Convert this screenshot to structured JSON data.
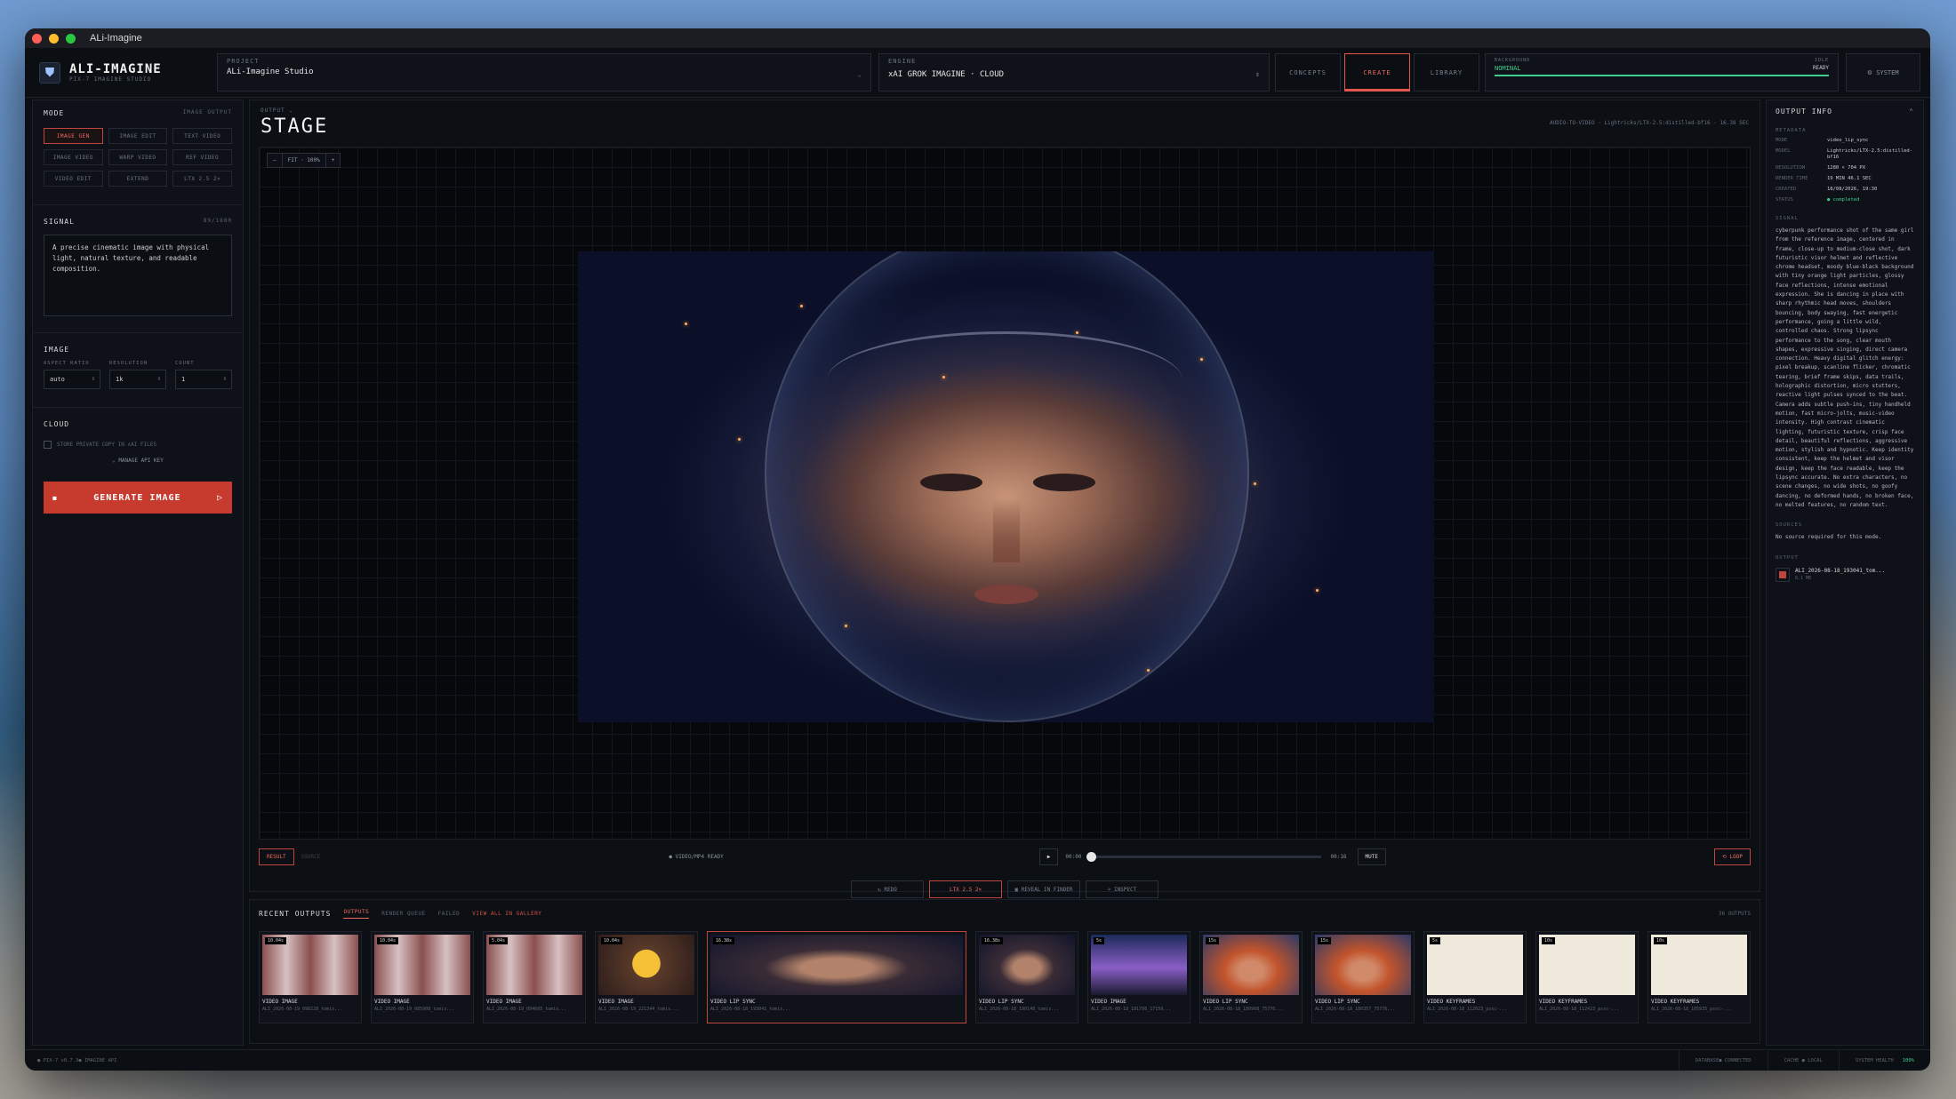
{
  "window": {
    "title": "ALi-Imagine"
  },
  "brand": {
    "name": "ALI-IMAGINE",
    "sub": "PIX-7 IMAGINE STUDIO"
  },
  "project": {
    "label": "PROJECT",
    "value": "ALi-Imagine Studio"
  },
  "engine": {
    "label": "ENGINE",
    "value": "xAI GROK IMAGINE · CLOUD"
  },
  "nav": {
    "concepts": "CONCEPTS",
    "create": "CREATE",
    "library": "LIBRARY"
  },
  "background": {
    "label": "BACKGROUND",
    "status": "NOMINAL",
    "idle": "IDLE",
    "ready": "READY"
  },
  "system": {
    "label": "SYSTEM"
  },
  "mode": {
    "title": "MODE",
    "right": "IMAGE OUTPUT",
    "buttons": [
      "IMAGE GEN",
      "IMAGE EDIT",
      "TEXT VIDEO",
      "IMAGE VIDEO",
      "WARP VIDEO",
      "REF VIDEO",
      "VIDEO EDIT",
      "EXTEND",
      "LTX 2.5 2×"
    ]
  },
  "signal": {
    "title": "SIGNAL",
    "count": "89/1800",
    "text": "A precise cinematic image with physical light, natural texture, and readable composition."
  },
  "image": {
    "title": "IMAGE",
    "aspect": {
      "label": "ASPECT RATIO",
      "value": "auto"
    },
    "resolution": {
      "label": "RESOLUTION",
      "value": "1k"
    },
    "count": {
      "label": "COUNT",
      "value": "1"
    }
  },
  "cloud": {
    "title": "CLOUD",
    "store": "STORE PRIVATE COPY IN xAI FILES",
    "apikey": "⌄ MANAGE API KEY"
  },
  "generate": {
    "label": "GENERATE IMAGE",
    "arrow": "▷"
  },
  "stage": {
    "output_label": "OUTPUT ⌄",
    "title": "STAGE",
    "meta": "AUDIO-TO-VIDEO · Lightricks/LTX-2.5:distilled-bf16 · 16.38 SEC",
    "zoom": {
      "minus": "–",
      "fit": "FIT · 100%",
      "plus": "+"
    }
  },
  "controls": {
    "result": "RESULT",
    "source": "SOURCE",
    "ready": "● VIDEO/MP4 READY",
    "play": "▶",
    "time_start": "00:00",
    "time_end": "00:16",
    "mute": "MUTE",
    "loop": "⟲ LOOP"
  },
  "actions": [
    "↻ REDO",
    "LTX 2.5 2×",
    "▣ REVEAL IN FINDER",
    "⌕ INSPECT"
  ],
  "recent": {
    "title": "RECENT OUTPUTS",
    "tabs": [
      "OUTPUTS",
      "RENDER QUEUE",
      "FAILED"
    ],
    "gallery": "VIEW ALL IN GALLERY",
    "count": "36 OUTPUTS",
    "items": [
      {
        "badge": "10.04s",
        "kind": "VIDEO IMAGE",
        "file": "ALI_2026-08-19_090228_tomis..."
      },
      {
        "badge": "10.04s",
        "kind": "VIDEO IMAGE",
        "file": "ALI_2026-08-19_085908_tomis..."
      },
      {
        "badge": "5.04s",
        "kind": "VIDEO IMAGE",
        "file": "ALI_2026-08-19_084605_tomis..."
      },
      {
        "badge": "10.04s",
        "kind": "VIDEO IMAGE",
        "file": "ALI_2026-08-19_221344_tomis..."
      },
      {
        "badge": "16.38s",
        "kind": "VIDEO LIP SYNC",
        "file": "ALI_2026-08-18_193041_tomis..."
      },
      {
        "badge": "16.38s",
        "kind": "VIDEO LIP SYNC",
        "file": "ALI_2026-08-18_190148_tomis..."
      },
      {
        "badge": "5s",
        "kind": "VIDEO IMAGE",
        "file": "ALI_2026-08-18_181706_17159..."
      },
      {
        "badge": "15s",
        "kind": "VIDEO LIP SYNC",
        "file": "ALI_2026-08-18_180908_75776..."
      },
      {
        "badge": "15s",
        "kind": "VIDEO LIP SYNC",
        "file": "ALI_2026-08-18_180357_75776..."
      },
      {
        "badge": "5s",
        "kind": "VIDEO KEYFRAMES",
        "file": "ALI_2026-08-18_112023_pssc-..."
      },
      {
        "badge": "10s",
        "kind": "VIDEO KEYFRAMES",
        "file": "ALI_2026-08-18_112423_pssc-..."
      },
      {
        "badge": "10s",
        "kind": "VIDEO KEYFRAMES",
        "file": "ALI_2026-08-18_105935_pssc-..."
      }
    ]
  },
  "info": {
    "title": "OUTPUT INFO",
    "metadata_label": "METADATA",
    "rows": [
      {
        "k": "MODE",
        "v": "video_lip_sync"
      },
      {
        "k": "MODEL",
        "v": "Lightricks/LTX-2.5:distilled-bf16"
      },
      {
        "k": "RESOLUTION",
        "v": "1280 × 704 PX"
      },
      {
        "k": "RENDER TIME",
        "v": "19 MIN 46.1 SEC"
      },
      {
        "k": "CREATED",
        "v": "18/08/2026, 19:30"
      },
      {
        "k": "STATUS",
        "v": "● completed"
      }
    ],
    "signal_label": "SIGNAL",
    "signal": "cyberpunk performance shot of the same girl from the reference image, centered in frame, close-up to medium-close shot, dark futuristic visor helmet and reflective chrome headset, moody blue-black background with tiny orange light particles, glossy face reflections, intense emotional expression. She is dancing in place with sharp rhythmic head moves, shoulders bouncing, body swaying, fast energetic performance, going a little wild, controlled chaos. Strong lipsync performance to the song, clear mouth shapes, expressive singing, direct camera connection. Heavy digital glitch energy: pixel breakup, scanline flicker, chromatic tearing, brief frame skips, data trails, holographic distortion, micro stutters, reactive light pulses synced to the beat. Camera adds subtle push-ins, tiny handheld motion, fast micro-jolts, music-video intensity. High contrast cinematic lighting, futuristic texture, crisp face detail, beautiful reflections, aggressive motion, stylish and hypnotic. Keep identity consistent, keep the helmet and visor design, keep the face readable, keep the lipsync accurate. No extra characters, no scene changes, no wide shots, no goofy dancing, no deformed hands, no broken face, no melted features, no random text.",
    "sources_label": "SOURCES",
    "sources": "No source required for this mode.",
    "output_label": "OUTPUT",
    "output_file": "ALI_2026-08-18_193041_tom...",
    "output_size": "8.1 MB"
  },
  "status": {
    "version": "● PIX-7 v0.7.3● IMAGINE API",
    "database": "DATABASE● CONNECTED",
    "cache": "CACHE ● LOCAL",
    "health": "SYSTEM HEALTH",
    "health_value": "100%"
  },
  "colors": {
    "accent": "#e2574c",
    "success": "#3ecf8e"
  }
}
